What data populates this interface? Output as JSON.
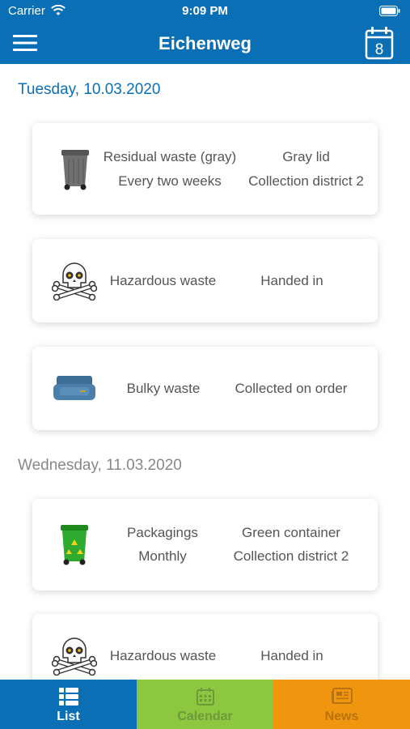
{
  "status_bar": {
    "carrier": "Carrier",
    "time": "9:09 PM"
  },
  "header": {
    "title": "Eichenweg",
    "calendar_day": "8"
  },
  "days": [
    {
      "date": "Tuesday, 10.03.2020",
      "entries": [
        {
          "type": "Residual waste (gray)",
          "container": "Gray lid",
          "interval": "Every two weeks",
          "district": "Collection district 2",
          "icon": "gray-bin-icon"
        },
        {
          "type": "Hazardous waste",
          "container": "Handed in",
          "icon": "skull-crossbones-icon"
        },
        {
          "type": "Bulky waste",
          "container": "Collected on order",
          "icon": "sofa-icon"
        }
      ]
    },
    {
      "date": "Wednesday, 11.03.2020",
      "entries": [
        {
          "type": "Packagings",
          "container": "Green container",
          "interval": "Monthly",
          "district": "Collection district 2",
          "icon": "green-bin-icon"
        },
        {
          "type": "Hazardous waste",
          "container": "Handed in",
          "icon": "skull-crossbones-icon"
        }
      ]
    }
  ],
  "tabs": [
    {
      "label": "List",
      "icon": "list-icon",
      "color": "#0a6fb5",
      "text_color": "#ffffff"
    },
    {
      "label": "Calendar",
      "icon": "calendar-icon",
      "color": "#8dc63f",
      "text_color": "#6f9a3a"
    },
    {
      "label": "News",
      "icon": "newspaper-icon",
      "color": "#f0960e",
      "text_color": "#b9740f"
    }
  ],
  "colors": {
    "brand": "#0a6fb5",
    "active_date": "#0a6fb5",
    "inactive_date": "#888888"
  }
}
